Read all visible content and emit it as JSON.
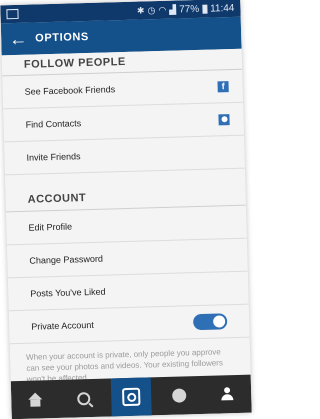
{
  "status_bar": {
    "battery": "77%",
    "time": "11:44",
    "icons": [
      "notification-icon",
      "bluetooth-icon",
      "alarm-icon",
      "wifi-icon",
      "signal-icon",
      "battery-icon"
    ]
  },
  "header": {
    "title": "OPTIONS",
    "back_icon": "back-arrow-icon"
  },
  "follow_people": {
    "title": "FOLLOW PEOPLE",
    "items": [
      {
        "label": "See Facebook Friends",
        "icon": "facebook-icon"
      },
      {
        "label": "Find Contacts",
        "icon": "contacts-icon"
      },
      {
        "label": "Invite Friends"
      }
    ]
  },
  "account": {
    "title": "ACCOUNT",
    "items": [
      {
        "label": "Edit Profile"
      },
      {
        "label": "Change Password"
      },
      {
        "label": "Posts You've Liked"
      },
      {
        "label": "Private Account",
        "toggle_on": true
      }
    ],
    "private_hint": "When your account is private, only people you approve can see your photos and videos. Your existing followers won't be affected."
  },
  "bottom_nav": {
    "tabs": [
      "home-icon",
      "search-icon",
      "camera-icon",
      "activity-icon",
      "profile-icon"
    ],
    "active": "camera-icon"
  },
  "colors": {
    "status_bar": "#10396b",
    "header": "#14508a",
    "accent": "#2f6fb5",
    "nav_bar": "#2c2c2c"
  }
}
